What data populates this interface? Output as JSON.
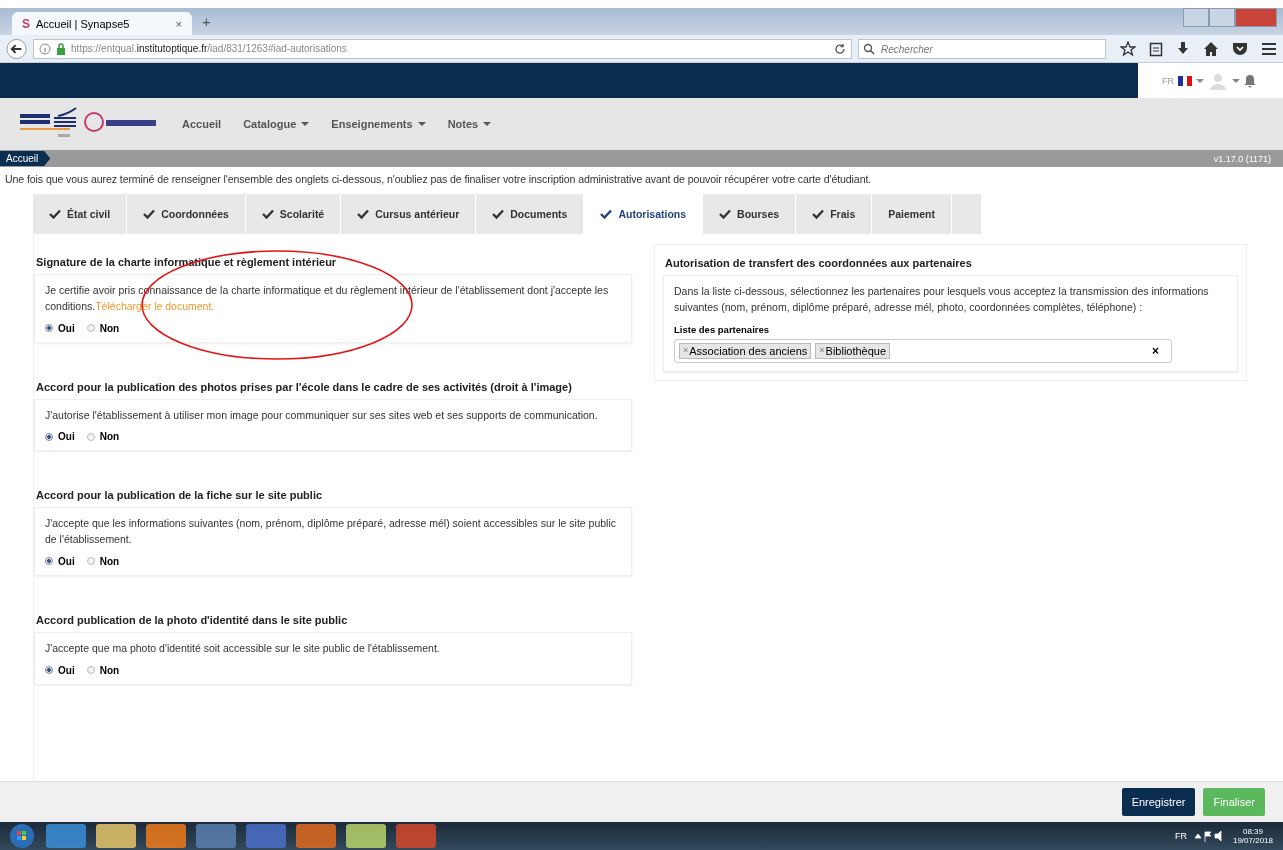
{
  "browser": {
    "favicon": "S",
    "tab_title": "Accueil | Synapse5",
    "tab_close": "×",
    "new_tab": "+",
    "url": "https://entqual.**institutoptique.fr**/iad/831/1263#iad-autorisations",
    "search_placeholder": "Rechercher"
  },
  "header": {
    "language": "FR"
  },
  "nav": {
    "items": [
      {
        "label": "Accueil",
        "dropdown": false
      },
      {
        "label": "Catalogue",
        "dropdown": true
      },
      {
        "label": "Enseignements",
        "dropdown": true
      },
      {
        "label": "Notes",
        "dropdown": true
      }
    ]
  },
  "breadcrumb": {
    "item": "Accueil",
    "version": "v1.17.0 (1171)"
  },
  "intro": "Une fois que vous aurez terminé de renseigner l'ensemble des onglets ci-dessous, n'oubliez pas de finaliser votre inscription administrative avant de pouvoir récupérer votre carte d'étudiant.",
  "tabs": [
    {
      "label": "État civil",
      "completed": true,
      "selected": false
    },
    {
      "label": "Coordonnées",
      "completed": true,
      "selected": false
    },
    {
      "label": "Scolarité",
      "completed": true,
      "selected": false
    },
    {
      "label": "Cursus antérieur",
      "completed": true,
      "selected": false
    },
    {
      "label": "Documents",
      "completed": true,
      "selected": false
    },
    {
      "label": "Autorisations",
      "completed": true,
      "selected": true
    },
    {
      "label": "Bourses",
      "completed": true,
      "selected": false
    },
    {
      "label": "Frais",
      "completed": true,
      "selected": false
    },
    {
      "label": "Paiement",
      "completed": false,
      "selected": false
    }
  ],
  "sections": [
    {
      "title": "Signature de la charte informatique et règlement intérieur",
      "text": "Je certifie avoir pris connaissance de la charte informatique et du règlement intérieur de l'établissement dont j'accepte les conditions.",
      "link": "Télécharger le document.",
      "options": [
        {
          "label": "Oui",
          "selected": true
        },
        {
          "label": "Non",
          "selected": false
        }
      ]
    },
    {
      "title": "Accord pour la publication des photos prises par l'école dans le cadre de ses activités (droit à l'image)",
      "text": "J'autorise l'établissement à utiliser mon image pour communiquer sur ses sites web et ses supports de communication.",
      "options": [
        {
          "label": "Oui",
          "selected": true
        },
        {
          "label": "Non",
          "selected": false
        }
      ]
    },
    {
      "title": "Accord pour la publication de la fiche sur le site public",
      "text": "J'accepte que les informations suivantes (nom, prénom, diplôme préparé, adresse mél) soient accessibles sur le site public de l'établissement.",
      "options": [
        {
          "label": "Oui",
          "selected": true
        },
        {
          "label": "Non",
          "selected": false
        }
      ]
    },
    {
      "title": "Accord publication de la photo d'identité dans le site public",
      "text": "J'accepte que ma photo d'identité soit accessible sur le site public de l'établissement.",
      "options": [
        {
          "label": "Oui",
          "selected": true
        },
        {
          "label": "Non",
          "selected": false
        }
      ]
    }
  ],
  "partners": {
    "title": "Autorisation de transfert des coordonnées aux partenaires",
    "text": "Dans la liste ci-dessous, sélectionnez les partenaires pour lesquels vous acceptez la transmission des informations suivantes (nom, prénom, diplôme préparé, adresse mél, photo, coordonnées complètes, téléphone) :",
    "field_label": "Liste des partenaires",
    "tags": [
      "Association des anciens",
      "Bibliothèque"
    ],
    "tag_remove": "×",
    "clear": "×"
  },
  "buttons": [
    {
      "label": "Enregistrer",
      "kind": "primary"
    },
    {
      "label": "Finaliser",
      "kind": "success"
    }
  ],
  "taskbar": {
    "language": "FR",
    "time": "08:39",
    "date": "19/07/2018"
  }
}
